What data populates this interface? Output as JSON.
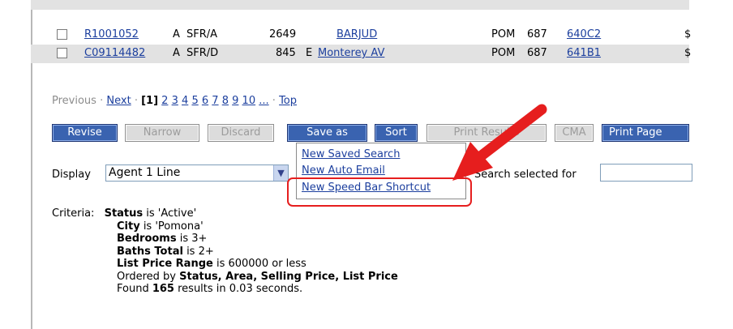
{
  "rows": [
    {
      "mls": "C09114482 ",
      "status": "A",
      "type": "SFR/D",
      "num": "845",
      "dir": "E",
      "street": "Monterey AV",
      "city": "POM",
      "area": "687",
      "page": "641B1",
      "price": "$"
    },
    {
      "mls": "R1001052",
      "status": "A",
      "type": "SFR/A",
      "num": "2649",
      "dir": "",
      "street": "BARJUD",
      "city": "POM",
      "area": "687",
      "page": "640C2",
      "price": "$"
    }
  ],
  "pager": {
    "previous": "Previous",
    "sep": "·",
    "next": "Next",
    "current": "[1]",
    "pages": [
      "2",
      "3",
      "4",
      "5",
      "6",
      "7",
      "8",
      "9",
      "10",
      "..."
    ],
    "top": "Top"
  },
  "buttons": {
    "revise": "Revise",
    "narrow": "Narrow",
    "discard": "Discard",
    "save_as": "Save as",
    "sort": "Sort",
    "print_results": "Print Results",
    "cma": "CMA",
    "print_page": "Print Page"
  },
  "save_menu": {
    "items": [
      "New Saved Search",
      "New Auto Email",
      "New Speed Bar Shortcut"
    ]
  },
  "display": {
    "label": "Display",
    "value": "Agent 1 Line",
    "search_label": "Search selected for"
  },
  "criteria": {
    "label": "Criteria:",
    "lines": [
      {
        "bold": "Status",
        "rest": " is 'Active'"
      },
      {
        "bold": "City",
        "rest": " is 'Pomona'"
      },
      {
        "bold": "Bedrooms",
        "rest": " is 3+"
      },
      {
        "bold": "Baths Total",
        "rest": " is 2+"
      },
      {
        "bold": "List Price Range",
        "rest": " is 600000 or less"
      }
    ],
    "ordered_prefix": "Ordered by ",
    "ordered_fields": "Status, Area, Selling Price, List Price",
    "found_prefix": "Found ",
    "found_count": "165",
    "found_suffix": " results in 0.03 seconds."
  },
  "colors": {
    "accent_button": "#3a63b0",
    "link": "#1c3f9e",
    "annotation_red": "#e61e1e"
  }
}
